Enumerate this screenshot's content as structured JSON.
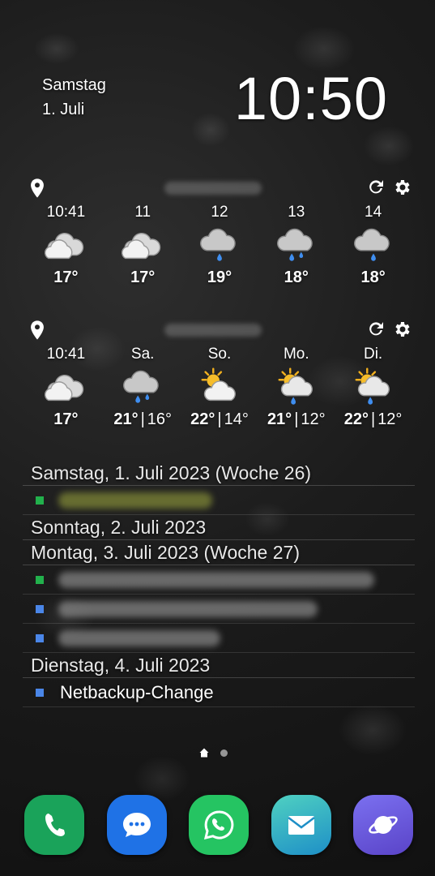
{
  "lockscreen": {
    "day_name": "Samstag",
    "date": "1. Juli",
    "time": "10:50"
  },
  "weather_hourly": {
    "icons": [
      "pin-icon",
      "refresh-icon",
      "gear-icon"
    ],
    "columns": [
      {
        "label": "10:41",
        "icon": "cloudy-icon",
        "temp": "17°"
      },
      {
        "label": "11",
        "icon": "cloudy-icon",
        "temp": "17°"
      },
      {
        "label": "12",
        "icon": "rain-cloud-icon",
        "temp": "19°"
      },
      {
        "label": "13",
        "icon": "rain-cloud-icon",
        "temp": "18°"
      },
      {
        "label": "14",
        "icon": "rain-cloud-icon",
        "temp": "18°"
      }
    ]
  },
  "weather_daily": {
    "icons": [
      "pin-icon",
      "refresh-icon",
      "gear-icon"
    ],
    "columns": [
      {
        "label": "10:41",
        "icon": "cloudy-icon",
        "hi": "17°"
      },
      {
        "label": "Sa.",
        "icon": "rain-cloud-icon",
        "hi": "21°",
        "sep": "|",
        "lo": "16°"
      },
      {
        "label": "So.",
        "icon": "sun-cloud-icon",
        "hi": "22°",
        "sep": "|",
        "lo": "14°"
      },
      {
        "label": "Mo.",
        "icon": "sun-rain-icon",
        "hi": "21°",
        "sep": "|",
        "lo": "12°"
      },
      {
        "label": "Di.",
        "icon": "sun-rain-icon",
        "hi": "22°",
        "sep": "|",
        "lo": "12°"
      }
    ]
  },
  "agenda": {
    "days": [
      {
        "header": "Samstag, 1. Juli 2023 (Woche 26)"
      },
      {
        "header": "Sonntag, 2. Juli 2023"
      },
      {
        "header": "Montag, 3. Juli 2023 (Woche 27)"
      },
      {
        "header": "Dienstag, 4. Juli 2023",
        "event": "Netbackup-Change"
      }
    ],
    "colors": {
      "green": "#22b14c",
      "blue": "#4a86e8"
    }
  },
  "dock": {
    "apps": [
      "phone-app",
      "messages-app",
      "whatsapp-app",
      "email-app",
      "internet-app"
    ]
  }
}
